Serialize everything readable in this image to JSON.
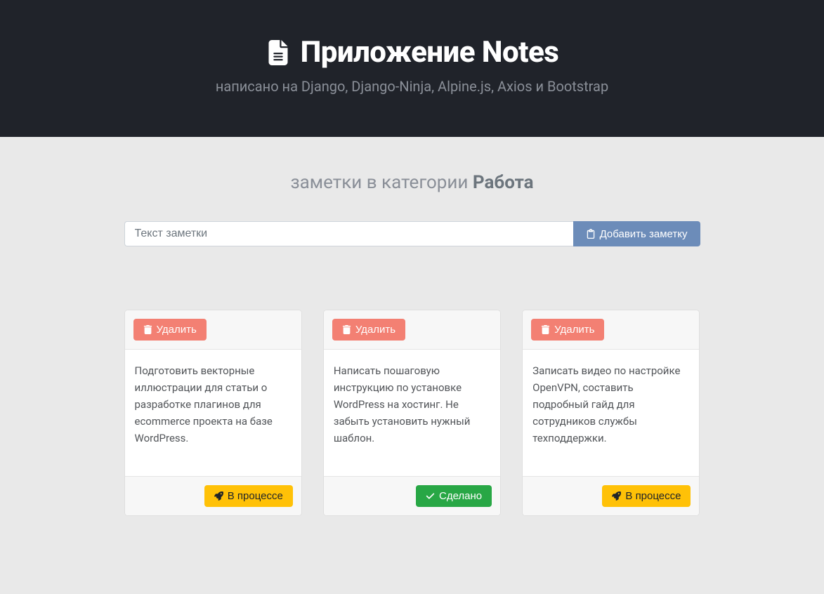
{
  "header": {
    "title": "Приложение Notes",
    "subtitle": "написано на Django, Django-Ninja, Alpine.js, Axios и Bootstrap"
  },
  "section": {
    "prefix": "заметки в категории ",
    "category": "Работа"
  },
  "input": {
    "placeholder": "Текст заметки",
    "add_label": "Добавить заметку"
  },
  "labels": {
    "delete": "Удалить",
    "in_progress": "В процессе",
    "done": "Сделано"
  },
  "notes": [
    {
      "text": "Подготовить векторные иллюстрации для статьи о разработке плагинов для ecommerce проекта на базе WordPress.",
      "status": "in_progress"
    },
    {
      "text": "Написать пошаговую инструкцию по установке WordPress на хостинг. Не забыть установить нужный шаблон.",
      "status": "done"
    },
    {
      "text": "Записать видео по настройке OpenVPN, составить подробный гайд для сотрудников службы техподдержки.",
      "status": "in_progress"
    }
  ]
}
